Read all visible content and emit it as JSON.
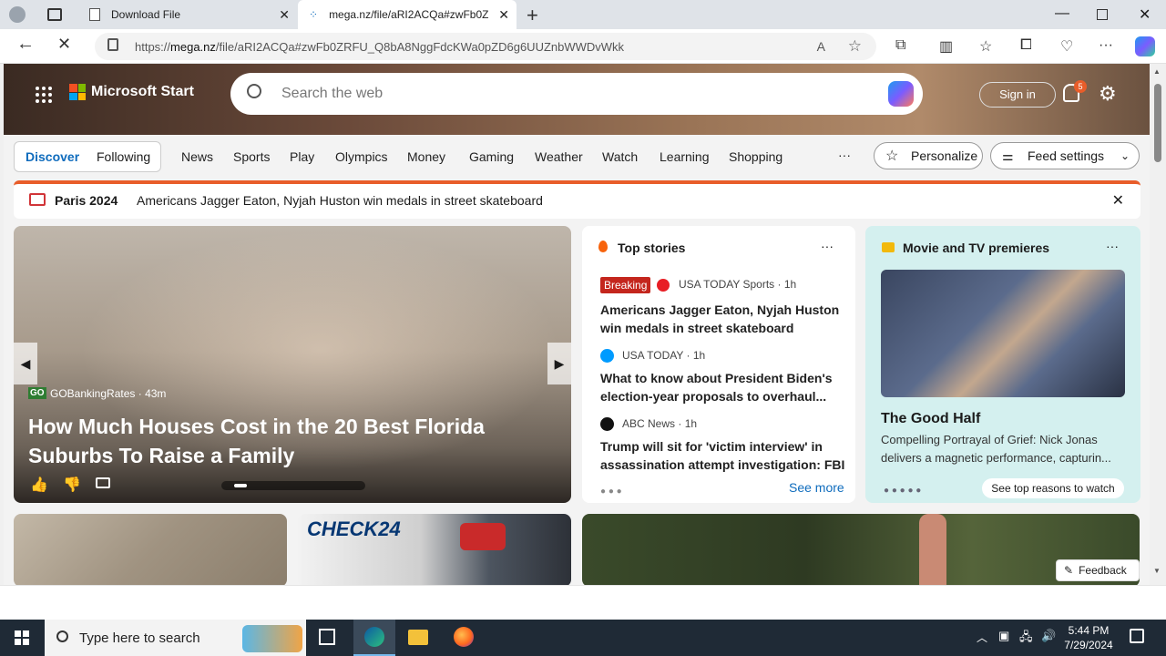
{
  "browser": {
    "tabs": [
      {
        "title": "Download File"
      },
      {
        "title": "mega.nz/file/aRI2ACQa#zwFb0Z..."
      }
    ],
    "url_prefix": "https://",
    "url_domain": "mega.nz",
    "url_path": "/file/aRI2ACQa#zwFb0ZRFU_Q8bA8NggFdcKWa0pZD6g6UUZnbWWDvWkk"
  },
  "header": {
    "brand": "Microsoft Start",
    "search_placeholder": "Search the web",
    "signin": "Sign in",
    "notif_count": "5"
  },
  "nav": {
    "pill": [
      "Discover",
      "Following"
    ],
    "items": [
      "News",
      "Sports",
      "Play",
      "Olympics",
      "Money",
      "Gaming",
      "Weather",
      "Watch",
      "Learning",
      "Shopping"
    ],
    "more": "···",
    "personalize": "Personalize",
    "feed_settings": "Feed settings"
  },
  "alert": {
    "tag": "Paris 2024",
    "text": "Americans Jagger Eaton, Nyjah Huston win medals in street skateboard"
  },
  "hero_card": {
    "source": "GOBankingRates",
    "age": "43m",
    "title_line1": "How Much Houses Cost in the 20 Best Florida",
    "title_line2": "Suburbs To Raise a Family"
  },
  "top_stories": {
    "heading": "Top stories",
    "items": [
      {
        "badge": "Breaking",
        "source": "USA TODAY Sports",
        "age": "1h",
        "line1": "Americans Jagger Eaton, Nyjah Huston",
        "line2": "win medals in street skateboard"
      },
      {
        "source": "USA TODAY",
        "age": "1h",
        "line1": "What to know about President Biden's",
        "line2": "election-year proposals to overhaul..."
      },
      {
        "source": "ABC News",
        "age": "1h",
        "line1": "Trump will sit for 'victim interview' in",
        "line2": "assassination attempt investigation: FBI"
      }
    ],
    "see_more": "See more"
  },
  "premieres": {
    "heading": "Movie and TV premieres",
    "title": "The Good Half",
    "line1": "Compelling Portrayal of Grief: Nick Jonas",
    "line2": "delivers a magnetic performance, capturin...",
    "cta": "See top reasons to watch"
  },
  "bottom": {
    "brand_tile": "CHECK24",
    "feedback": "Feedback"
  },
  "taskbar": {
    "search_placeholder": "Type here to search",
    "time": "5:44 PM",
    "date": "7/29/2024"
  },
  "colors": {
    "accent": "#0f6cbd",
    "breaking": "#c4261d",
    "alert_bar": "#e85d2a"
  }
}
